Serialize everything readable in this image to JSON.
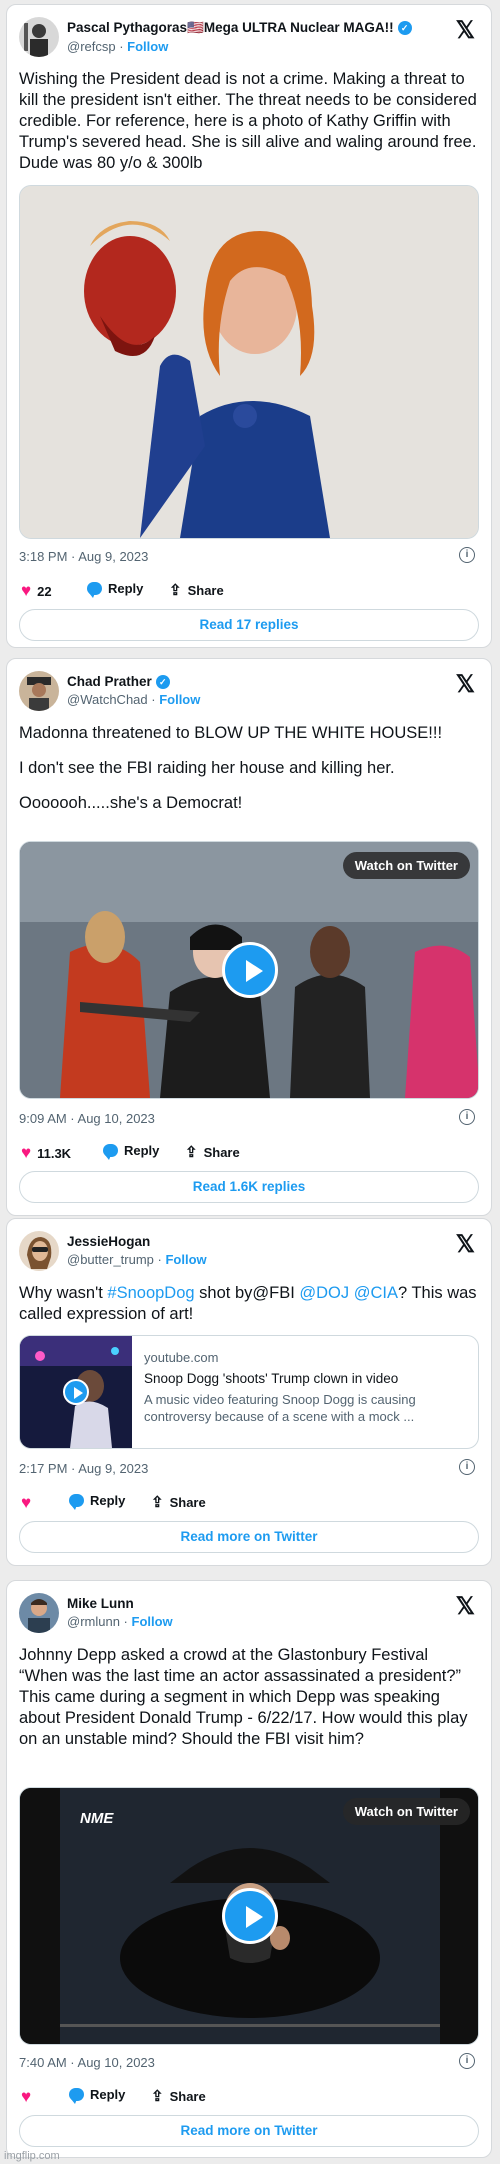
{
  "tweets": [
    {
      "author": "Pascal Pythagoras🇺🇸Mega ULTRA Nuclear MAGA!!",
      "handle": "@refcsp",
      "follow": "Follow",
      "paragraphs": [
        "Wishing the President dead is not a crime. Making a threat to kill the president isn't either. The threat needs to be considered credible. For reference, here is a photo of Kathy Griffin with Trump's severed head. She is sill alive and waling around free. Dude was 80 y/o & 300lb"
      ],
      "timestamp": "3:18 PM · Aug 9, 2023",
      "likes": "22",
      "reply": "Reply",
      "share": "Share",
      "read_button": "Read 17 replies"
    },
    {
      "author": "Chad Prather",
      "handle": "@WatchChad",
      "follow": "Follow",
      "paragraphs": [
        "Madonna threatened to BLOW UP THE WHITE HOUSE!!!",
        "I don't see the FBI raiding her house and killing her.",
        "Ooooooh.....she's a Democrat!"
      ],
      "watch_label": "Watch on Twitter",
      "timestamp": "9:09 AM · Aug 10, 2023",
      "likes": "11.3K",
      "reply": "Reply",
      "share": "Share",
      "read_button": "Read 1.6K replies"
    },
    {
      "author": "JessieHogan",
      "handle": "@butter_trump",
      "follow": "Follow",
      "text_pre": "Why wasn't ",
      "link1": "#SnoopDog",
      "text_mid": " shot by@FBI ",
      "link2": "@DOJ",
      "text_space": " ",
      "link3": "@CIA",
      "text_post": "? This was called expression of art!",
      "link_card": {
        "domain": "youtube.com",
        "title": "Snoop Dogg 'shoots' Trump clown in video",
        "description": "A music video featuring Snoop Dogg is causing controversy because of a scene with a mock ..."
      },
      "timestamp": "2:17 PM · Aug 9, 2023",
      "reply": "Reply",
      "share": "Share",
      "read_button": "Read more on Twitter"
    },
    {
      "author": "Mike Lunn",
      "handle": "@rmlunn",
      "follow": "Follow",
      "paragraphs": [
        "Johnny Depp asked a crowd at the Glastonbury Festival “When was the last time an actor assassinated a president?” This came during a segment in which Depp was speaking about President Donald Trump - 6/22/17. How would this play on an unstable mind? Should the FBI visit him?"
      ],
      "watch_label": "Watch on Twitter",
      "video_logo": "NME",
      "timestamp": "7:40 AM · Aug 10, 2023",
      "reply": "Reply",
      "share": "Share",
      "read_button": "Read more on Twitter"
    }
  ],
  "watermark": "imgflip.com",
  "colors": {
    "accent": "#1d9bf0",
    "like": "#f91880",
    "muted": "#536471"
  },
  "icons": [
    "verified-badge-icon",
    "x-logo-icon",
    "heart-icon",
    "reply-bubble-icon",
    "share-icon",
    "info-icon",
    "play-icon"
  ]
}
